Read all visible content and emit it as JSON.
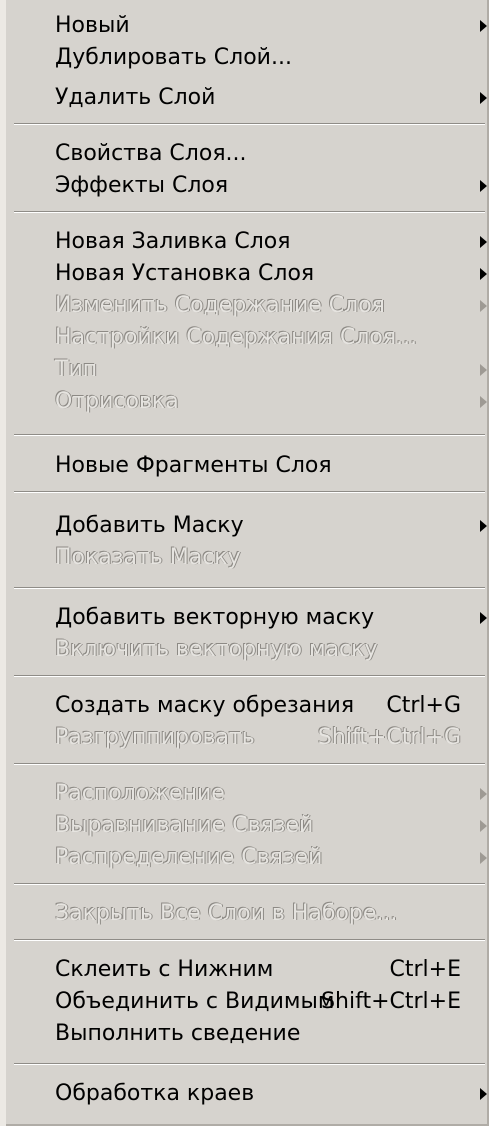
{
  "menu": {
    "items": [
      {
        "label": "Новый",
        "shortcut": "",
        "submenu": true,
        "enabled": true
      },
      {
        "label": "Дублировать Слой...",
        "shortcut": "",
        "submenu": false,
        "enabled": true
      },
      {
        "label": "Удалить Слой",
        "shortcut": "",
        "submenu": true,
        "enabled": true
      },
      {
        "label": "Свойства Слоя...",
        "shortcut": "",
        "submenu": false,
        "enabled": true
      },
      {
        "label": "Эффекты Слоя",
        "shortcut": "",
        "submenu": true,
        "enabled": true
      },
      {
        "label": "Новая Заливка Слоя",
        "shortcut": "",
        "submenu": true,
        "enabled": true
      },
      {
        "label": "Новая Установка Слоя",
        "shortcut": "",
        "submenu": true,
        "enabled": true
      },
      {
        "label": "Изменить Содержание Слоя",
        "shortcut": "",
        "submenu": true,
        "enabled": false
      },
      {
        "label": "Настройки Содержания Слоя...",
        "shortcut": "",
        "submenu": false,
        "enabled": false
      },
      {
        "label": "Тип",
        "shortcut": "",
        "submenu": true,
        "enabled": false
      },
      {
        "label": "Отрисовка",
        "shortcut": "",
        "submenu": true,
        "enabled": false
      },
      {
        "label": "Новые Фрагменты Слоя",
        "shortcut": "",
        "submenu": false,
        "enabled": true
      },
      {
        "label": "Добавить Маску",
        "shortcut": "",
        "submenu": true,
        "enabled": true
      },
      {
        "label": "Показать Маску",
        "shortcut": "",
        "submenu": false,
        "enabled": false
      },
      {
        "label": "Добавить векторную маску",
        "shortcut": "",
        "submenu": true,
        "enabled": true
      },
      {
        "label": "Включить векторную маску",
        "shortcut": "",
        "submenu": false,
        "enabled": false
      },
      {
        "label": "Создать маску обрезания",
        "shortcut": "Ctrl+G",
        "submenu": false,
        "enabled": true
      },
      {
        "label": "Разгруппировать",
        "shortcut": "Shift+Ctrl+G",
        "submenu": false,
        "enabled": false
      },
      {
        "label": "Расположение",
        "shortcut": "",
        "submenu": true,
        "enabled": false
      },
      {
        "label": "Выравнивание Связей",
        "shortcut": "",
        "submenu": true,
        "enabled": false
      },
      {
        "label": "Распределение Связей",
        "shortcut": "",
        "submenu": true,
        "enabled": false
      },
      {
        "label": "Закрыть Все Слои в Наборе...",
        "shortcut": "",
        "submenu": false,
        "enabled": false
      },
      {
        "label": "Склеить с Нижним",
        "shortcut": "Ctrl+E",
        "submenu": false,
        "enabled": true
      },
      {
        "label": "Объединить с Видимым",
        "shortcut": "Shift+Ctrl+E",
        "submenu": false,
        "enabled": true
      },
      {
        "label": "Выполнить сведение",
        "shortcut": "",
        "submenu": false,
        "enabled": true
      },
      {
        "label": "Обработка краев",
        "shortcut": "",
        "submenu": true,
        "enabled": true
      }
    ],
    "separator_after": [
      2,
      4,
      10,
      11,
      13,
      15,
      17,
      20,
      21,
      24
    ]
  }
}
